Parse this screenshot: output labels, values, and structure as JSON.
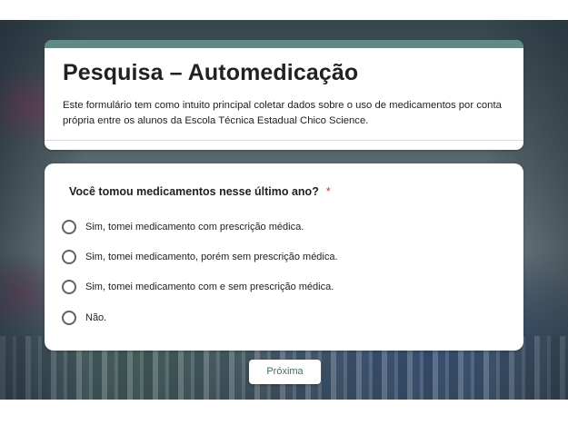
{
  "theme": {
    "accent": "#5f8a86",
    "required_color": "#d93025",
    "button_text_color": "#3c6e6a"
  },
  "form": {
    "title": "Pesquisa – Automedicação",
    "description": "Este formulário tem como intuito principal coletar dados sobre o uso de medicamentos por conta própria entre os alunos da Escola Técnica Estadual Chico Science."
  },
  "question": {
    "text": "Você tomou medicamentos nesse último ano?",
    "required_marker": "*",
    "options": [
      {
        "label": "Sim, tomei medicamento com prescrição médica."
      },
      {
        "label": "Sim, tomei medicamento, porém sem prescrição médica."
      },
      {
        "label": "Sim, tomei medicamento com e sem prescrição médica."
      },
      {
        "label": "Não."
      }
    ]
  },
  "navigation": {
    "next_label": "Próxima"
  }
}
